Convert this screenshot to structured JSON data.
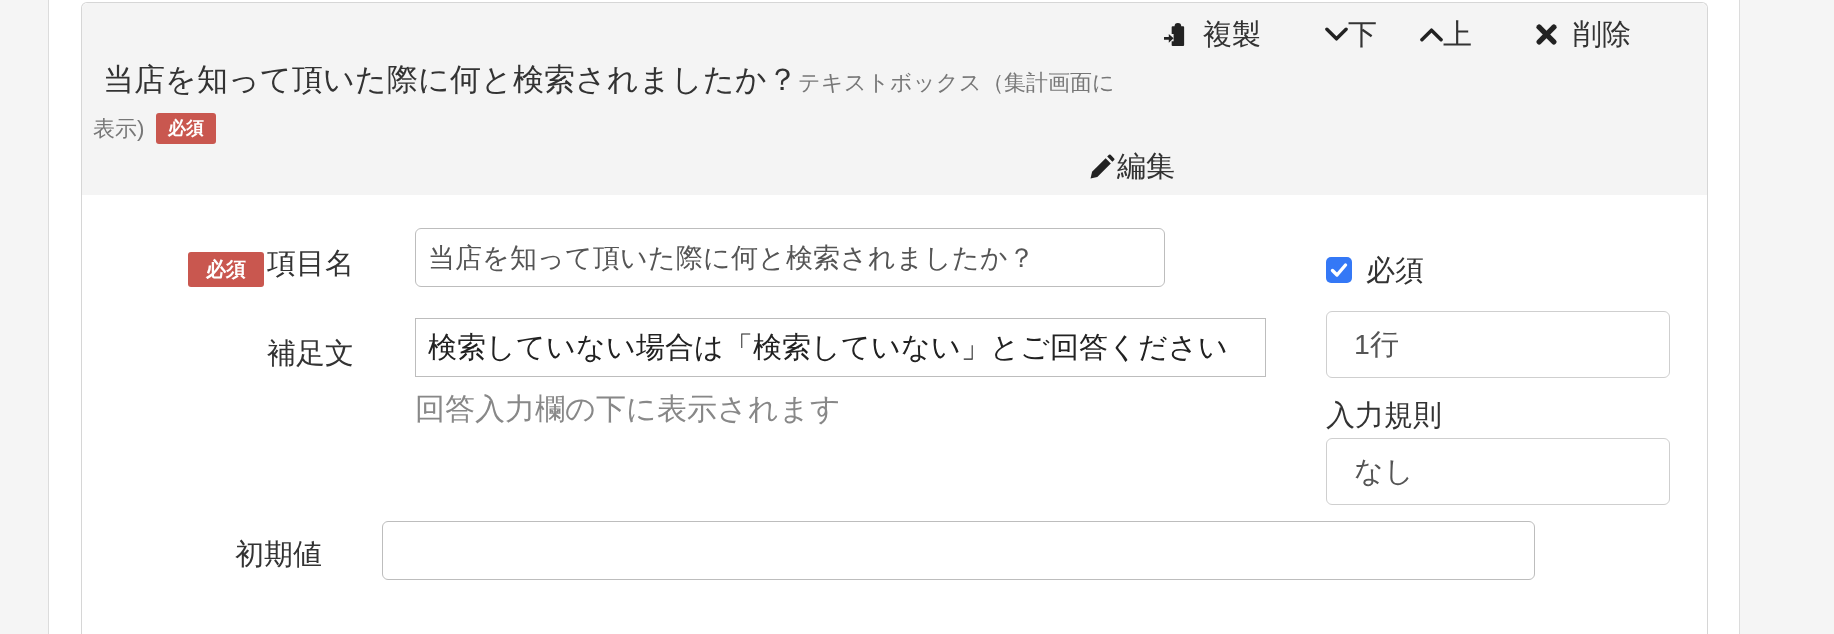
{
  "toolbar": [
    {
      "kind": "duplicate",
      "label": "複製"
    },
    {
      "kind": "down",
      "label": "下"
    },
    {
      "kind": "up",
      "label": "上"
    },
    {
      "kind": "delete",
      "label": "削除"
    }
  ],
  "question": {
    "title": "当店を知って頂いた際に何と検索されましたか？",
    "type_note_lines": [
      "テキストボックス（集計画面に",
      "表示)"
    ],
    "badge": "必須"
  },
  "edit_button": {
    "label": "編集"
  },
  "form": {
    "item_name": {
      "badge": "必須",
      "label": "項目名",
      "value": "当店を知って頂いた際に何と検索されましたか？"
    },
    "supplement": {
      "label": "補足文",
      "value": "検索していない場合は「検索していない」とご回答ください",
      "help": "回答入力欄の下に表示されます"
    },
    "required": {
      "label": "必須",
      "checked": true
    },
    "rows": {
      "value": "1行"
    },
    "input_rule": {
      "label": "入力規則",
      "value": "なし"
    },
    "initial_value": {
      "label": "初期値"
    }
  }
}
